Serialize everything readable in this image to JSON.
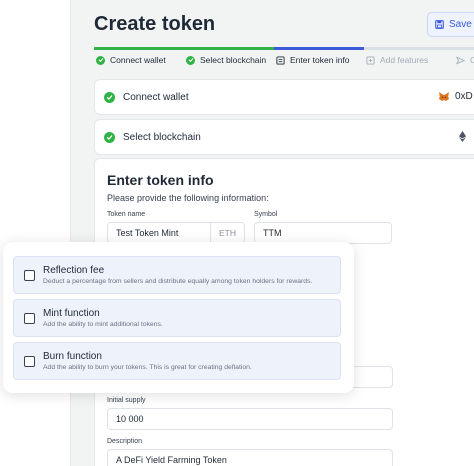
{
  "header": {
    "title": "Create token",
    "save_label": "Save &"
  },
  "steps": [
    {
      "label": "Connect wallet",
      "state": "done"
    },
    {
      "label": "Select blockchain",
      "state": "done"
    },
    {
      "label": "Enter token info",
      "state": "current"
    },
    {
      "label": "Add features",
      "state": "pending"
    },
    {
      "label": "C",
      "state": "pending"
    }
  ],
  "summary": {
    "wallet": {
      "label": "Connect wallet",
      "value": "0xD"
    },
    "blockchain": {
      "label": "Select blockchain"
    }
  },
  "token_info": {
    "heading": "Enter token info",
    "subheading": "Please provide the following information:",
    "token_name_label": "Token name",
    "token_name_value": "Test Token Mint",
    "token_name_suffix": "ETH",
    "symbol_label": "Symbol",
    "symbol_value": "TTM",
    "initial_supply_label": "Initial supply",
    "initial_supply_value": "10 000",
    "description_label": "Description",
    "description_value": "A DeFi Yield Farming Token"
  },
  "features": [
    {
      "title": "Reflection fee",
      "description": "Deduct a percentage from sellers and distribute equally among token holders for rewards.",
      "checked": false
    },
    {
      "title": "Mint function",
      "description": "Add the ability to mint additional tokens.",
      "checked": false
    },
    {
      "title": "Burn function",
      "description": "Add the ability to burn your tokens. This is great for creating deflation.",
      "checked": false
    }
  ],
  "colors": {
    "done": "#2fb344",
    "current": "#3b5bdb",
    "pending": "#d9dfe3"
  },
  "icons": {
    "save": "save-icon",
    "check": "check-circle-icon",
    "wallet": "metamask-fox-icon",
    "chain": "ethereum-icon"
  }
}
